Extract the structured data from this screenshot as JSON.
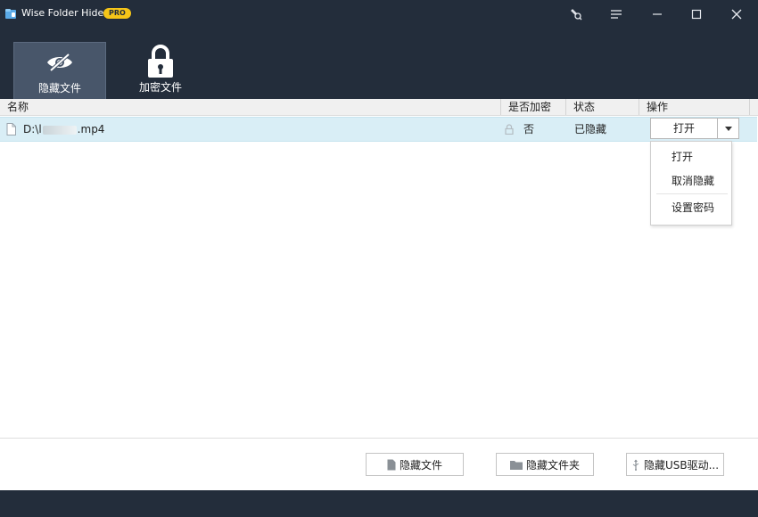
{
  "window": {
    "title": "Wise Folder Hider",
    "badge": "PRO",
    "controls": [
      "tools-icon",
      "menu-icon",
      "minimize-icon",
      "maximize-icon",
      "close-icon"
    ]
  },
  "tabs": [
    {
      "label": "隐藏文件",
      "icon": "eye-hide-icon",
      "active": true
    },
    {
      "label": "加密文件",
      "icon": "lock-icon",
      "active": false
    }
  ],
  "table": {
    "columns": [
      "名称",
      "是否加密",
      "状态",
      "操作"
    ],
    "rows": [
      {
        "name_prefix": "D:\\",
        "name_suffix": "mp4",
        "name_mid": "l",
        "encrypted": "否",
        "status": "已隐藏",
        "action": "打开",
        "icon": "file-icon"
      }
    ]
  },
  "dropdown": {
    "items": [
      "打开",
      "取消隐藏",
      "设置密码"
    ]
  },
  "footer": {
    "buttons": [
      {
        "label": "隐藏文件",
        "icon": "file-icon"
      },
      {
        "label": "隐藏文件夹",
        "icon": "folder-icon"
      },
      {
        "label": "隐藏USB驱动...",
        "icon": "usb-icon"
      }
    ]
  },
  "colors": {
    "header_bg": "#232d3b",
    "active_tab": "#48566a",
    "badge": "#f5c518",
    "row_highlight": "#d9eef6"
  }
}
